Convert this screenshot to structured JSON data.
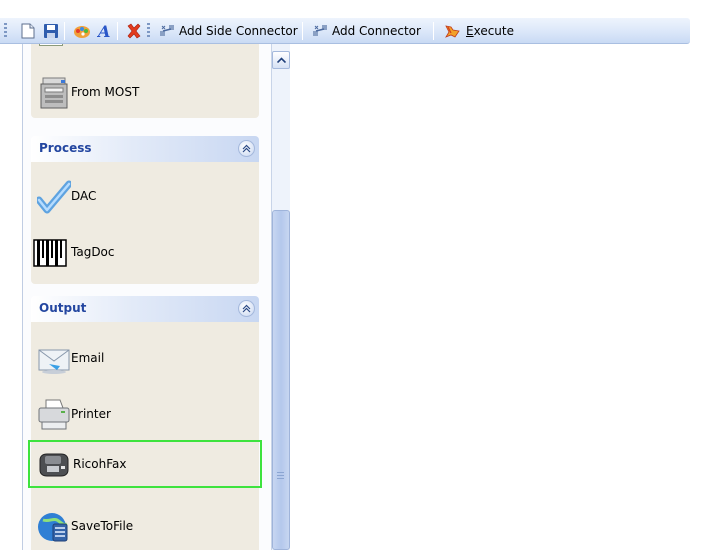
{
  "toolbar": {
    "buttons": [
      {
        "name": "new-icon"
      },
      {
        "name": "save-icon"
      },
      {
        "name": "color-icon"
      },
      {
        "name": "font-icon"
      },
      {
        "name": "delete-icon"
      }
    ],
    "add_side_connector": "Add Side Connector",
    "add_connector": "Add Connector",
    "execute_mnemonic": "E",
    "execute_rest": "xecute"
  },
  "sections": {
    "input": {
      "items": [
        {
          "label": "From MOST",
          "icon": "scanner-copier-icon"
        }
      ]
    },
    "process": {
      "title": "Process",
      "items": [
        {
          "label": "DAC",
          "icon": "checkmark-icon"
        },
        {
          "label": "TagDoc",
          "icon": "barcode-icon"
        }
      ]
    },
    "output": {
      "title": "Output",
      "items": [
        {
          "label": "Email",
          "icon": "email-icon"
        },
        {
          "label": "Printer",
          "icon": "printer-icon"
        },
        {
          "label": "RicohFax",
          "icon": "fax-icon",
          "selected": true
        },
        {
          "label": "SaveToFile",
          "icon": "save-to-file-icon"
        }
      ]
    }
  },
  "colors": {
    "selection_border": "#3ee33e",
    "section_title": "#2346a0",
    "section_body": "#efebe1"
  }
}
